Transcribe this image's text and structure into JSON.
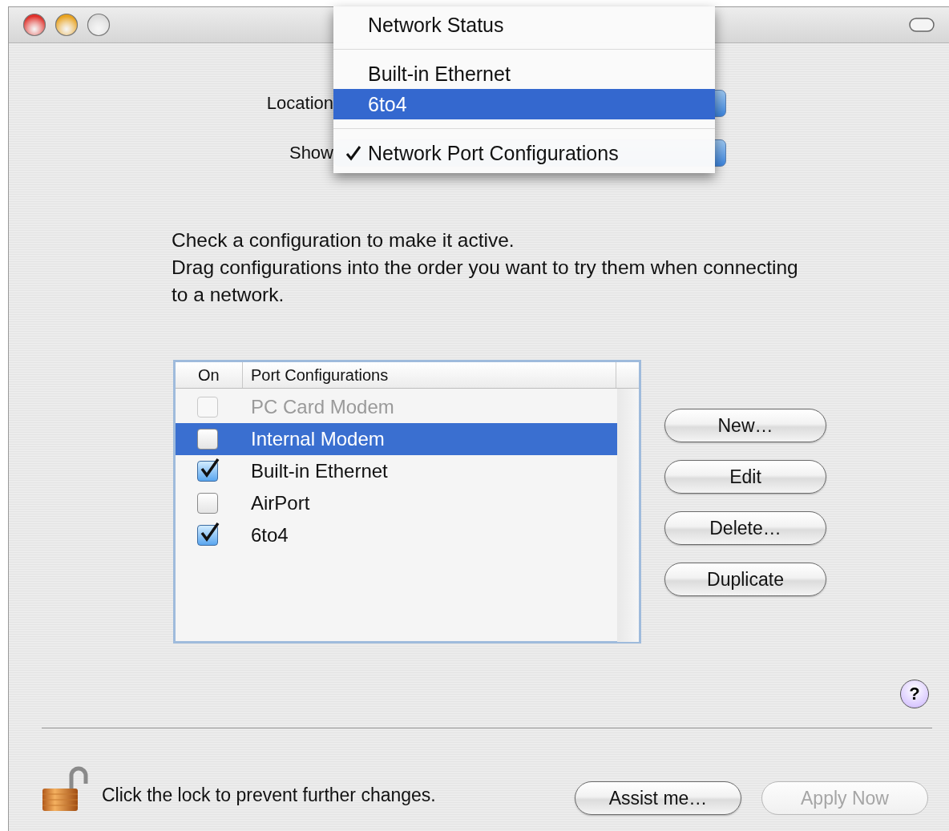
{
  "location": {
    "label": "Location"
  },
  "show": {
    "label": "Show"
  },
  "menu": {
    "items": [
      {
        "kind": "item",
        "label": "Network Status",
        "selected": false,
        "checked": false
      },
      {
        "kind": "separator"
      },
      {
        "kind": "item",
        "label": "Built-in Ethernet",
        "selected": false,
        "checked": false
      },
      {
        "kind": "item",
        "label": "6to4",
        "selected": true,
        "checked": false
      },
      {
        "kind": "separator"
      },
      {
        "kind": "item",
        "label": "Network Port Configurations",
        "selected": false,
        "checked": true
      }
    ]
  },
  "instructions": [
    "Check a configuration to make it active.",
    "Drag configurations into the order you want to try them when connecting to a network."
  ],
  "table": {
    "columns": [
      "On",
      "Port Configurations"
    ],
    "rows": [
      {
        "name": "PC Card Modem",
        "checked": false,
        "selected": false,
        "disabled": true
      },
      {
        "name": "Internal Modem",
        "checked": false,
        "selected": true,
        "disabled": false
      },
      {
        "name": "Built-in Ethernet",
        "checked": true,
        "selected": false,
        "disabled": false
      },
      {
        "name": "AirPort",
        "checked": false,
        "selected": false,
        "disabled": false
      },
      {
        "name": "6to4",
        "checked": true,
        "selected": false,
        "disabled": false
      }
    ]
  },
  "side_buttons": [
    {
      "label": "New…",
      "disabled": false
    },
    {
      "label": "Edit",
      "disabled": false
    },
    {
      "label": "Delete…",
      "disabled": false
    },
    {
      "label": "Duplicate",
      "disabled": false
    }
  ],
  "help": {
    "label": "?"
  },
  "lock": {
    "locked": false,
    "message": "Click the lock to prevent further changes."
  },
  "bottom_buttons": [
    {
      "label": "Assist me…",
      "disabled": false
    },
    {
      "label": "Apply Now",
      "disabled": true
    }
  ]
}
